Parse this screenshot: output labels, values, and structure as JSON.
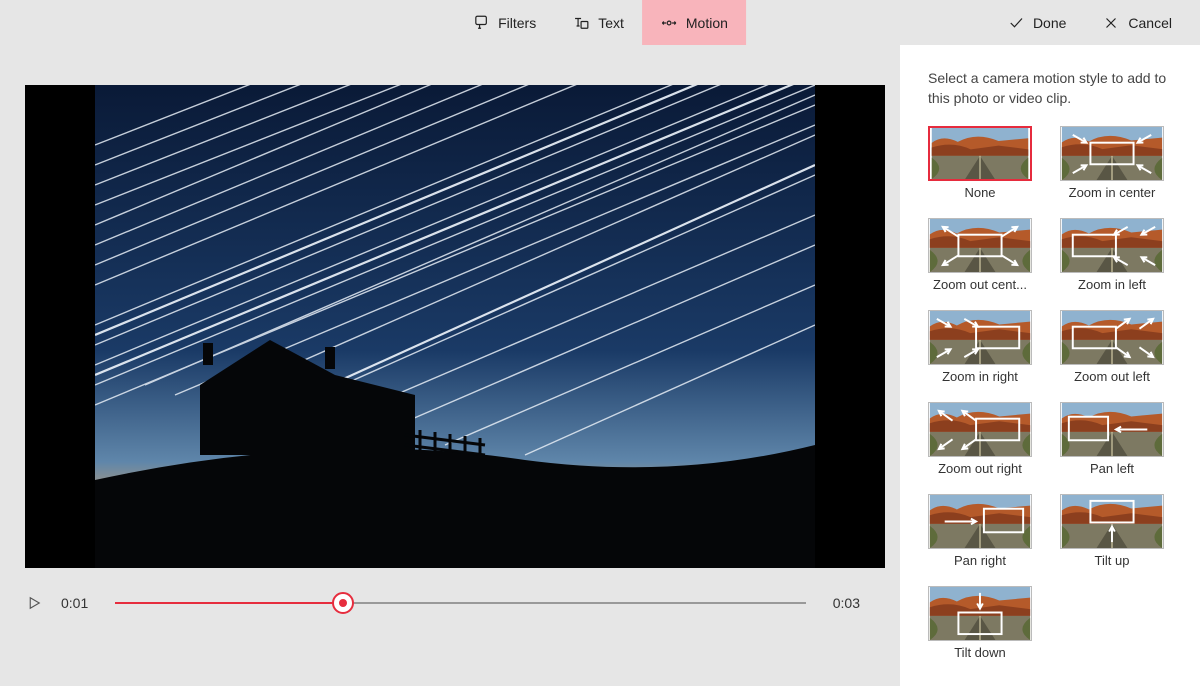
{
  "toolbar": {
    "center": [
      {
        "id": "filters",
        "label": "Filters",
        "active": false
      },
      {
        "id": "text",
        "label": "Text",
        "active": false
      },
      {
        "id": "motion",
        "label": "Motion",
        "active": true
      }
    ],
    "done": "Done",
    "cancel": "Cancel"
  },
  "playback": {
    "current": "0:01",
    "total": "0:03",
    "progress_pct": 33
  },
  "sidebar": {
    "title": "Select a camera motion style to add to this photo or video clip.",
    "selected": 0,
    "options": [
      {
        "id": "none",
        "label": "None"
      },
      {
        "id": "zoom-in-center",
        "label": "Zoom in center"
      },
      {
        "id": "zoom-out-center",
        "label": "Zoom out cent..."
      },
      {
        "id": "zoom-in-left",
        "label": "Zoom in left"
      },
      {
        "id": "zoom-in-right",
        "label": "Zoom in right"
      },
      {
        "id": "zoom-out-left",
        "label": "Zoom out left"
      },
      {
        "id": "zoom-out-right",
        "label": "Zoom out right"
      },
      {
        "id": "pan-left",
        "label": "Pan left"
      },
      {
        "id": "pan-right",
        "label": "Pan right"
      },
      {
        "id": "tilt-up",
        "label": "Tilt up"
      },
      {
        "id": "tilt-down",
        "label": "Tilt down"
      }
    ]
  }
}
